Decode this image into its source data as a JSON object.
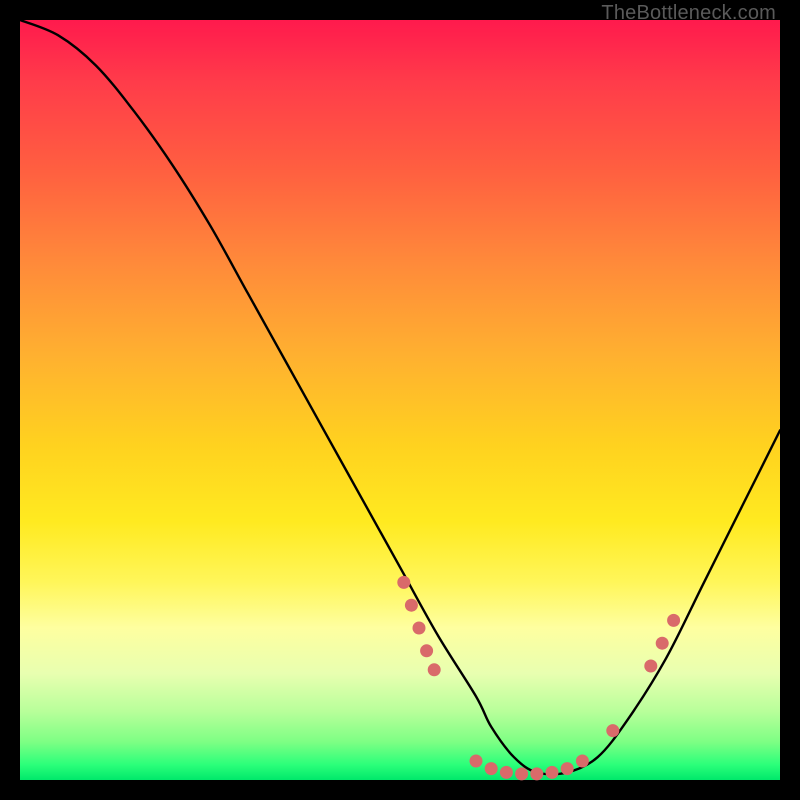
{
  "watermark": "TheBottleneck.com",
  "chart_data": {
    "type": "line",
    "title": "",
    "xlabel": "",
    "ylabel": "",
    "xlim": [
      0,
      100
    ],
    "ylim": [
      0,
      100
    ],
    "series": [
      {
        "name": "bottleneck-curve",
        "x": [
          0,
          5,
          10,
          15,
          20,
          25,
          30,
          35,
          40,
          45,
          50,
          55,
          60,
          62,
          65,
          68,
          72,
          76,
          80,
          85,
          90,
          95,
          100
        ],
        "y": [
          100,
          98,
          94,
          88,
          81,
          73,
          64,
          55,
          46,
          37,
          28,
          19,
          11,
          7,
          3,
          1,
          1,
          3,
          8,
          16,
          26,
          36,
          46
        ]
      }
    ],
    "markers": [
      {
        "x": 50.5,
        "y": 26
      },
      {
        "x": 51.5,
        "y": 23
      },
      {
        "x": 52.5,
        "y": 20
      },
      {
        "x": 53.5,
        "y": 17
      },
      {
        "x": 54.5,
        "y": 14.5
      },
      {
        "x": 60,
        "y": 2.5
      },
      {
        "x": 62,
        "y": 1.5
      },
      {
        "x": 64,
        "y": 1
      },
      {
        "x": 66,
        "y": 0.8
      },
      {
        "x": 68,
        "y": 0.8
      },
      {
        "x": 70,
        "y": 1
      },
      {
        "x": 72,
        "y": 1.5
      },
      {
        "x": 74,
        "y": 2.5
      },
      {
        "x": 78,
        "y": 6.5
      },
      {
        "x": 83,
        "y": 15
      },
      {
        "x": 84.5,
        "y": 18
      },
      {
        "x": 86,
        "y": 21
      }
    ],
    "gradient_stops": [
      {
        "offset": 0,
        "color": "#ff1a4d"
      },
      {
        "offset": 50,
        "color": "#ffd21f"
      },
      {
        "offset": 80,
        "color": "#feffa0"
      },
      {
        "offset": 100,
        "color": "#00e86b"
      }
    ],
    "marker_color": "#d96a6a"
  }
}
